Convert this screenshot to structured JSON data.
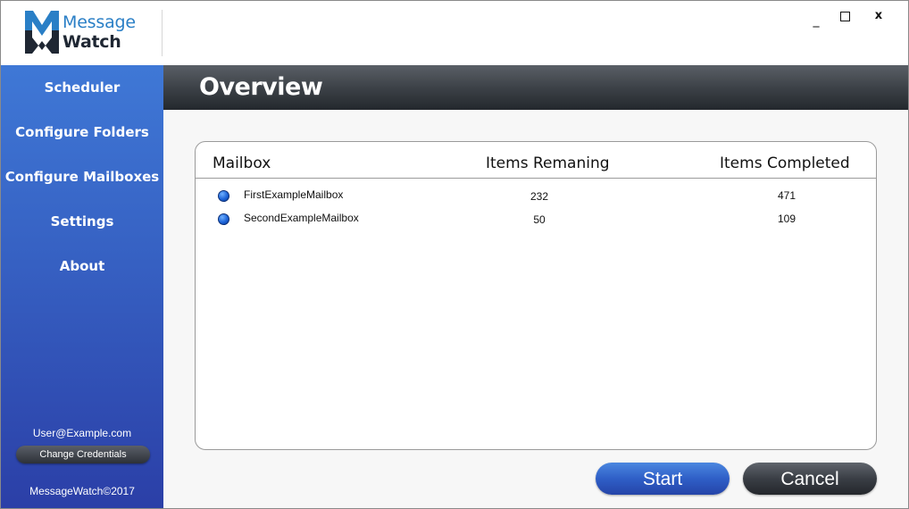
{
  "app": {
    "logo_line1": "Message",
    "logo_line2": "Watch",
    "window_controls": {
      "minimize": "_",
      "maximize": "□",
      "close": "x"
    }
  },
  "sidebar": {
    "items": [
      {
        "label": "Scheduler"
      },
      {
        "label": "Configure Folders"
      },
      {
        "label": "Configure Mailboxes"
      },
      {
        "label": "Settings"
      },
      {
        "label": "About"
      }
    ],
    "user_email": "User@Example.com",
    "change_credentials_label": "Change Credentials",
    "copyright": "MessageWatch©2017"
  },
  "header": {
    "title": "Overview"
  },
  "table": {
    "columns": [
      "Mailbox",
      "Items Remaning",
      "Items Completed"
    ],
    "rows": [
      {
        "mailbox": "FirstExampleMailbox",
        "remaining": "232",
        "completed": "471",
        "status_color": "#1d64d8"
      },
      {
        "mailbox": "SecondExampleMailbox",
        "remaining": "50",
        "completed": "109",
        "status_color": "#1d64d8"
      }
    ]
  },
  "actions": {
    "start_label": "Start",
    "cancel_label": "Cancel"
  },
  "colors": {
    "sidebar_top": "#3f78d6",
    "sidebar_bottom": "#2b3fa7",
    "header_dark": "#3a3f45",
    "start_button": "#2f5fc7",
    "cancel_button": "#3a3e45",
    "logo_blue": "#2a7fc6"
  }
}
